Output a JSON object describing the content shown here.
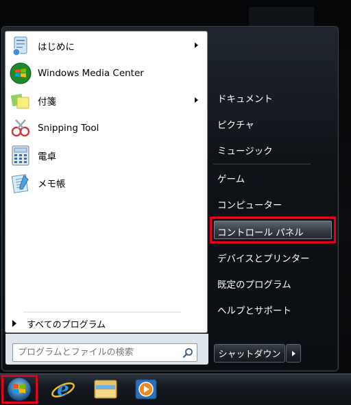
{
  "left_pane": {
    "programs": [
      {
        "label": "はじめに",
        "icon": "getting-started-icon",
        "has_submenu": true
      },
      {
        "label": "Windows Media Center",
        "icon": "media-center-icon",
        "has_submenu": false
      },
      {
        "label": "付箋",
        "icon": "sticky-notes-icon",
        "has_submenu": true
      },
      {
        "label": "Snipping Tool",
        "icon": "snipping-tool-icon",
        "has_submenu": false
      },
      {
        "label": "電卓",
        "icon": "calculator-icon",
        "has_submenu": false
      },
      {
        "label": "メモ帳",
        "icon": "notepad-icon",
        "has_submenu": false
      }
    ],
    "all_programs": "すべてのプログラム"
  },
  "search": {
    "placeholder": "プログラムとファイルの検索"
  },
  "right_pane": {
    "items": [
      "ドキュメント",
      "ピクチャ",
      "ミュージック",
      "ゲーム",
      "コンピューター",
      "コントロール パネル",
      "デバイスとプリンター",
      "既定のプログラム",
      "ヘルプとサポート"
    ],
    "highlighted": "コントロール パネル"
  },
  "shutdown": {
    "label": "シャットダウン"
  },
  "taskbar": {
    "icons": [
      "start-orb-icon",
      "internet-explorer-icon",
      "explorer-folder-icon",
      "media-player-icon"
    ]
  },
  "colors": {
    "highlight_frame": "#e4001b",
    "menu_dark": "#0f1318"
  }
}
